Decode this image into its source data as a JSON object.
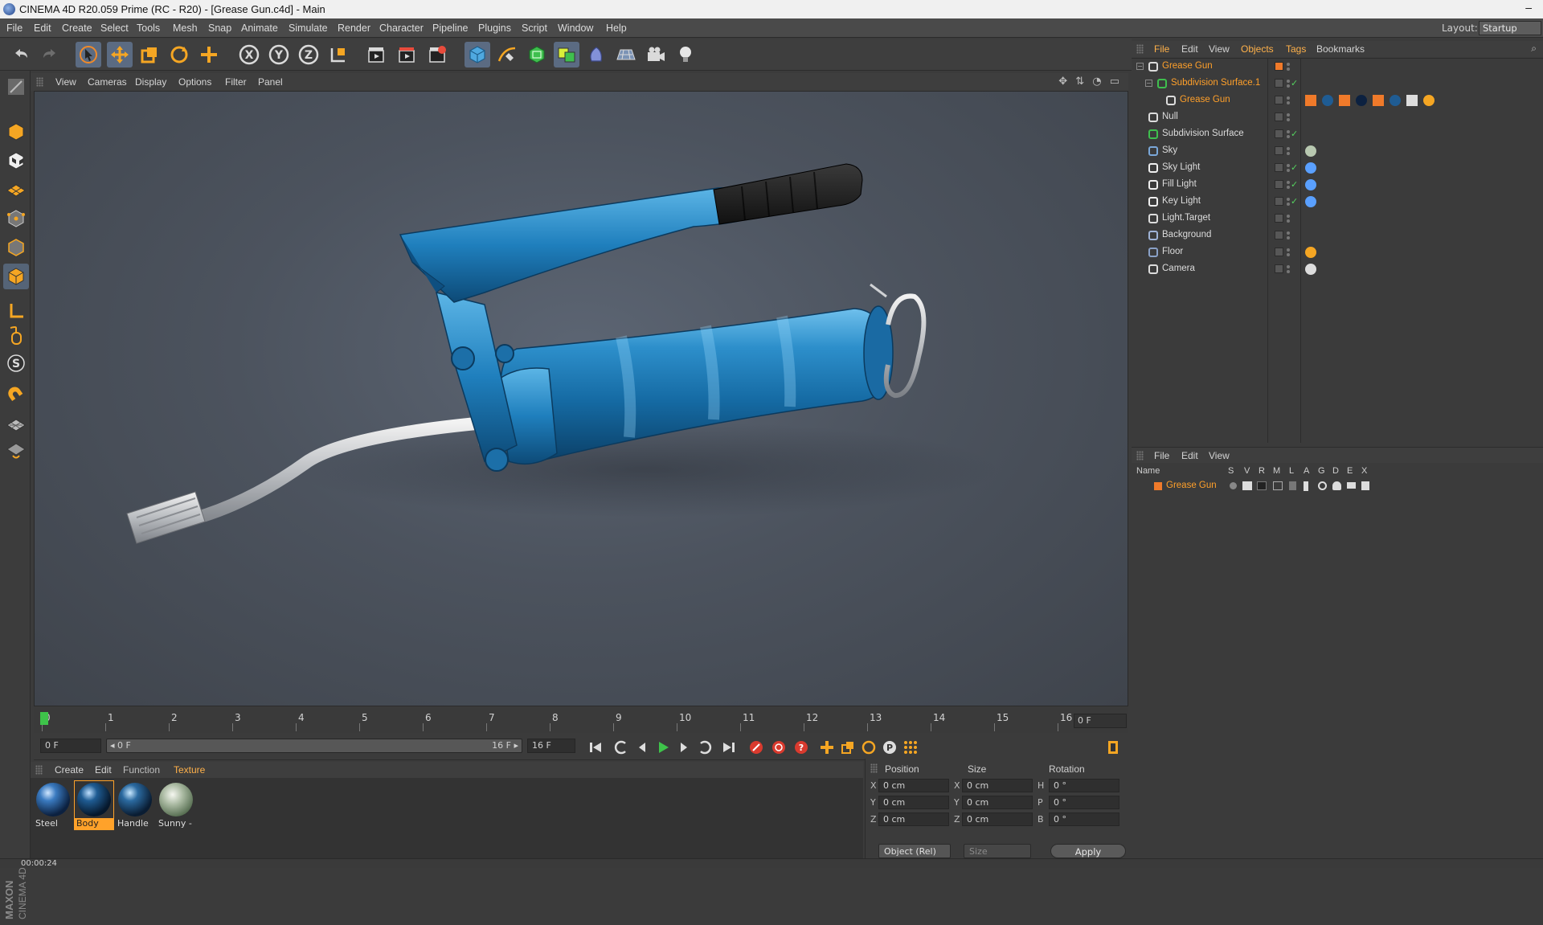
{
  "window": {
    "title": "CINEMA 4D R20.059 Prime (RC - R20) - [Grease Gun.c4d] - Main",
    "minimize": "–"
  },
  "menu": [
    "File",
    "Edit",
    "Create",
    "Select",
    "Tools",
    "Mesh",
    "Snap",
    "Animate",
    "Simulate",
    "Render",
    "Character",
    "Pipeline",
    "Plugins",
    "Script",
    "Window",
    "Help"
  ],
  "layout": {
    "label": "Layout:",
    "value": "Startup"
  },
  "toolbar": {
    "axis_x": "X",
    "axis_y": "Y",
    "axis_z": "Z"
  },
  "viewport_menu": [
    "View",
    "Cameras",
    "Display",
    "Options",
    "Filter",
    "Panel"
  ],
  "viewport_nav": "✥ ⇅ ◔ ▭",
  "timeline": {
    "ticks": [
      "0",
      "1",
      "2",
      "3",
      "4",
      "5",
      "6",
      "7",
      "8",
      "9",
      "10",
      "11",
      "12",
      "13",
      "14",
      "15",
      "16"
    ],
    "current_frame": "0 F",
    "current_frame_index": 0
  },
  "transport": {
    "start_field": "0 F",
    "range_start": "◂ 0 F",
    "range_end": "16 F ▸",
    "end_field": "16 F",
    "min_field": "16 F"
  },
  "materials": {
    "menu": [
      "Create",
      "Edit",
      "Function",
      "Texture"
    ],
    "items": [
      {
        "label": "Steel",
        "color": "#1e4c7c"
      },
      {
        "label": "Body",
        "color": "#0f3556"
      },
      {
        "label": "Handle",
        "color": "#1a3f5e"
      },
      {
        "label": "Sunny -",
        "color": "#8fa38c"
      }
    ],
    "selected_index": 1
  },
  "coordinates": {
    "headers": [
      "Position",
      "Size",
      "Rotation"
    ],
    "rows": [
      {
        "pos_axis": "X",
        "pos": "0 cm",
        "size_axis": "X",
        "size": "0 cm",
        "rot_axis": "H",
        "rot": "0 °"
      },
      {
        "pos_axis": "Y",
        "pos": "0 cm",
        "size_axis": "Y",
        "size": "0 cm",
        "rot_axis": "P",
        "rot": "0 °"
      },
      {
        "pos_axis": "Z",
        "pos": "0 cm",
        "size_axis": "Z",
        "size": "0 cm",
        "rot_axis": "B",
        "rot": "0 °"
      }
    ],
    "mode": "Object (Rel)",
    "size_mode": "Size",
    "apply": "Apply"
  },
  "status": {
    "time": "00:00:24"
  },
  "object_manager": {
    "menu": [
      "File",
      "Edit",
      "View",
      "Objects",
      "Tags",
      "Bookmarks"
    ],
    "highlighted_menu": "Objects",
    "objects": [
      {
        "name": "Grease Gun",
        "orange": true,
        "indent": 0,
        "check": false,
        "layer_orange": true
      },
      {
        "name": "Subdivision Surface.1",
        "orange": true,
        "indent": 1,
        "check": true,
        "layer_orange": false
      },
      {
        "name": "Grease Gun",
        "orange": true,
        "indent": 2,
        "check": false,
        "layer_orange": false
      },
      {
        "name": "Null",
        "orange": false,
        "indent": 0,
        "check": false,
        "layer_orange": false
      },
      {
        "name": "Subdivision Surface",
        "orange": false,
        "indent": 0,
        "check": true,
        "layer_orange": false
      },
      {
        "name": "Sky",
        "orange": false,
        "indent": 0,
        "check": false,
        "layer_orange": false
      },
      {
        "name": "Sky Light",
        "orange": false,
        "indent": 0,
        "check": true,
        "layer_orange": false
      },
      {
        "name": "Fill Light",
        "orange": false,
        "indent": 0,
        "check": true,
        "layer_orange": false
      },
      {
        "name": "Key Light",
        "orange": false,
        "indent": 0,
        "check": true,
        "layer_orange": false
      },
      {
        "name": "Light.Target",
        "orange": false,
        "indent": 0,
        "check": false,
        "layer_orange": false
      },
      {
        "name": "Background",
        "orange": false,
        "indent": 0,
        "check": false,
        "layer_orange": false
      },
      {
        "name": "Floor",
        "orange": false,
        "indent": 0,
        "check": false,
        "layer_orange": false
      },
      {
        "name": "Camera",
        "orange": false,
        "indent": 0,
        "check": false,
        "layer_orange": false
      }
    ]
  },
  "layer_manager": {
    "menu": [
      "File",
      "Edit",
      "View"
    ],
    "columns": [
      "Name",
      "S",
      "V",
      "R",
      "M",
      "L",
      "A",
      "G",
      "D",
      "E",
      "X"
    ],
    "layer_name": "Grease Gun"
  },
  "accent_color": "#ffa22a",
  "brand_vertical": "MAXON CINEMA 4D"
}
